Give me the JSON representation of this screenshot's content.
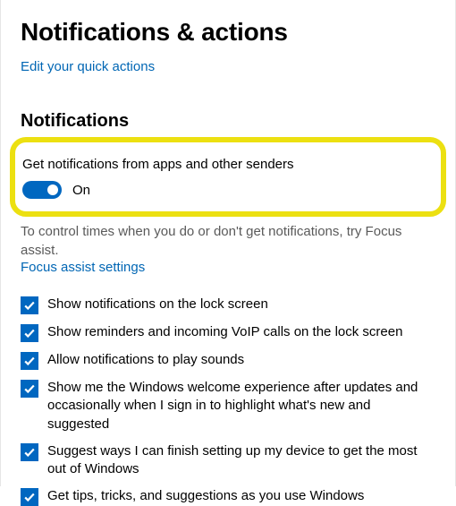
{
  "page_title": "Notifications & actions",
  "quick_actions_link": "Edit your quick actions",
  "section_title": "Notifications",
  "master_toggle": {
    "label": "Get notifications from apps and other senders",
    "state_label": "On",
    "on": true
  },
  "help_text": "To control times when you do or don't get notifications, try Focus assist.",
  "focus_assist_link": "Focus assist settings",
  "checkboxes": [
    {
      "label": "Show notifications on the lock screen",
      "checked": true
    },
    {
      "label": "Show reminders and incoming VoIP calls on the lock screen",
      "checked": true
    },
    {
      "label": "Allow notifications to play sounds",
      "checked": true
    },
    {
      "label": "Show me the Windows welcome experience after updates and occasionally when I sign in to highlight what's new and suggested",
      "checked": true
    },
    {
      "label": "Suggest ways I can finish setting up my device to get the most out of Windows",
      "checked": true
    },
    {
      "label": "Get tips, tricks, and suggestions as you use Windows",
      "checked": true
    }
  ],
  "colors": {
    "accent": "#0067c0",
    "link": "#0066b4",
    "highlight_border": "#ece011"
  }
}
